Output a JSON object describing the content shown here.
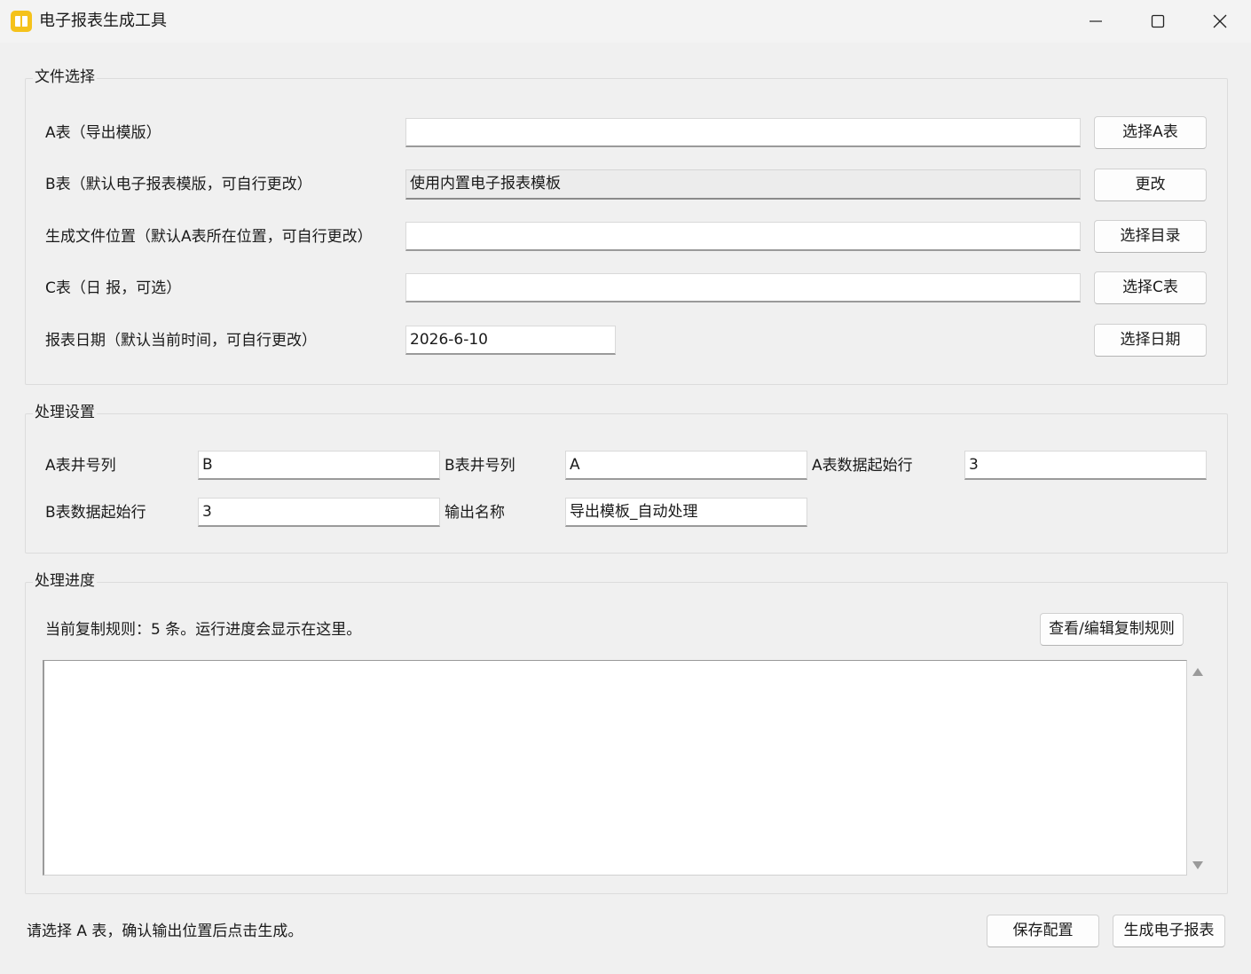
{
  "window": {
    "title": "电子报表生成工具",
    "icon": "notebook-icon"
  },
  "file_section": {
    "title": "文件选择",
    "rows": [
      {
        "label": "A表（导出模版）",
        "value": "",
        "button": "选择A表"
      },
      {
        "label": "B表（默认电子报表模版，可自行更改）",
        "value": "使用内置电子报表模板",
        "button": "更改"
      },
      {
        "label": "生成文件位置（默认A表所在位置，可自行更改）",
        "value": "",
        "button": "选择目录"
      },
      {
        "label": "C表（日 报，可选）",
        "value": "",
        "button": "选择C表"
      },
      {
        "label": "报表日期（默认当前时间，可自行更改）",
        "value": "2026-6-10",
        "button": "选择日期"
      }
    ]
  },
  "processing_section": {
    "title": "处理设置",
    "a_well_col_label": "A表井号列",
    "a_well_col_value": "B",
    "b_well_col_label": "B表井号列",
    "b_well_col_value": "A",
    "a_start_row_label": "A表数据起始行",
    "a_start_row_value": "3",
    "b_start_row_label": "B表数据起始行",
    "b_start_row_value": "3",
    "output_name_label": "输出名称",
    "output_name_value": "导出模板_自动处理"
  },
  "progress_section": {
    "title": "处理进度",
    "info": "当前复制规则：5 条。运行进度会显示在这里。",
    "edit_rules_button": "查看/编辑复制规则",
    "log": ""
  },
  "footer": {
    "status": "请选择 A 表，确认输出位置后点击生成。",
    "save_button": "保存配置",
    "generate_button": "生成电子报表"
  }
}
